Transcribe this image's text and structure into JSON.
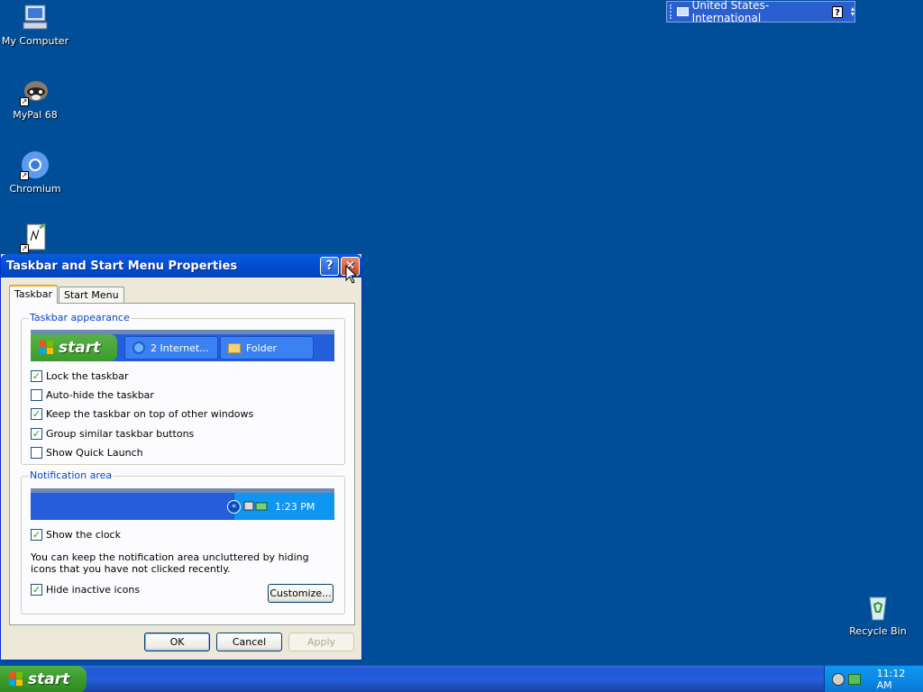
{
  "desktop": {
    "icons": [
      {
        "label": "My Computer"
      },
      {
        "label": "MyPal 68"
      },
      {
        "label": "Chromium"
      },
      {
        "label": ""
      }
    ],
    "recycle_bin": "Recycle Bin"
  },
  "language_bar": {
    "language": "United States-International",
    "help": "?"
  },
  "dialog": {
    "title": "Taskbar and Start Menu Properties",
    "tabs": [
      "Taskbar",
      "Start Menu"
    ],
    "appearance": {
      "title": "Taskbar appearance",
      "preview": {
        "start": "start",
        "btn1": "2 Internet...",
        "btn2": "Folder"
      },
      "options": [
        {
          "label": "Lock the taskbar",
          "checked": true
        },
        {
          "label": "Auto-hide the taskbar",
          "checked": false
        },
        {
          "label": "Keep the taskbar on top of other windows",
          "checked": true
        },
        {
          "label": "Group similar taskbar buttons",
          "checked": true
        },
        {
          "label": "Show Quick Launch",
          "checked": false
        }
      ]
    },
    "notification": {
      "title": "Notification area",
      "preview_time": "1:23 PM",
      "show_clock": {
        "label": "Show the clock",
        "checked": true
      },
      "description": "You can keep the notification area uncluttered by hiding icons that you have not clicked recently.",
      "hide_inactive": {
        "label": "Hide inactive icons",
        "checked": true
      },
      "customize": "Customize..."
    },
    "buttons": {
      "ok": "OK",
      "cancel": "Cancel",
      "apply": "Apply"
    }
  },
  "taskbar": {
    "start": "start",
    "clock": "11:12 AM"
  }
}
